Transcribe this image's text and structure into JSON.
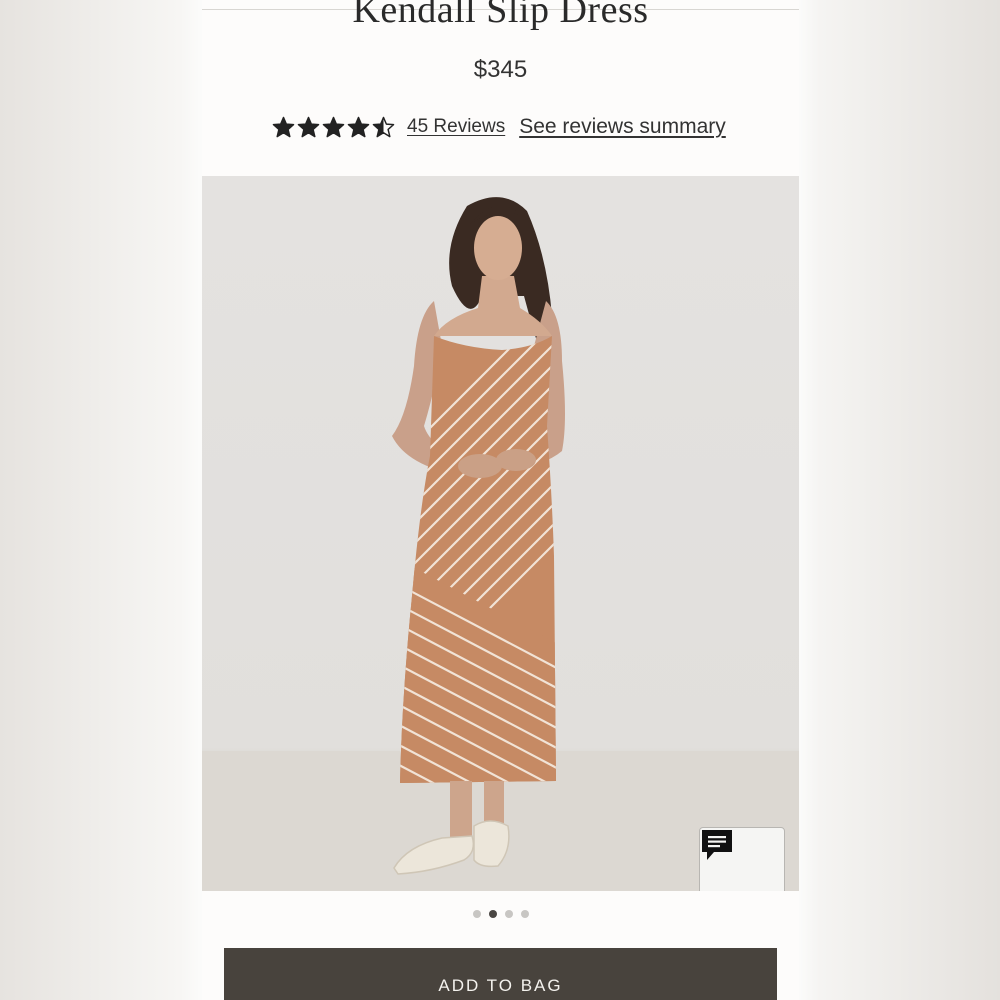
{
  "product": {
    "title": "Kendall Slip Dress",
    "price": "$345",
    "rating": 4.5,
    "rating_max": 5,
    "reviews_link": "45 Reviews",
    "summary_link": "See reviews summary"
  },
  "gallery": {
    "image_label": "Model wearing striped slip dress",
    "slide_count": 4,
    "active_slide": 2
  },
  "chat": {
    "icon": "chat-bubble-icon"
  },
  "actions": {
    "add_to_bag": "ADD TO BAG"
  },
  "colors": {
    "button_bg": "#48433d",
    "dress": "#c68a64",
    "text": "#333333"
  }
}
